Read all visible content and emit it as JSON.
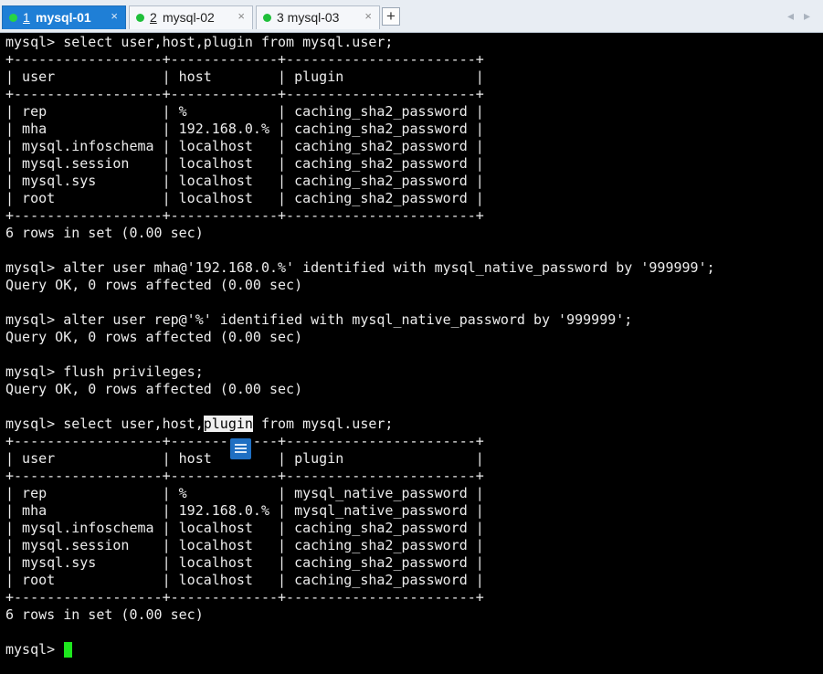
{
  "tabs": [
    {
      "number": "1",
      "label": "mysql-01",
      "active": true
    },
    {
      "number": "2",
      "label": "mysql-02",
      "active": false
    },
    {
      "number": "3",
      "label": "3 mysql-03",
      "active": false
    }
  ],
  "tab_close_glyph": "×",
  "add_tab_glyph": "+",
  "nav_prev_glyph": "◂",
  "nav_next_glyph": "▸",
  "terminal": {
    "lines": [
      "mysql> select user,host,plugin from mysql.user;",
      "+------------------+-------------+-----------------------+",
      "| user             | host        | plugin                |",
      "+------------------+-------------+-----------------------+",
      "| rep              | %           | caching_sha2_password |",
      "| mha              | 192.168.0.% | caching_sha2_password |",
      "| mysql.infoschema | localhost   | caching_sha2_password |",
      "| mysql.session    | localhost   | caching_sha2_password |",
      "| mysql.sys        | localhost   | caching_sha2_password |",
      "| root             | localhost   | caching_sha2_password |",
      "+------------------+-------------+-----------------------+",
      "6 rows in set (0.00 sec)",
      "",
      "mysql> alter user mha@'192.168.0.%' identified with mysql_native_password by '999999';",
      "Query OK, 0 rows affected (0.00 sec)",
      "",
      "mysql> alter user rep@'%' identified with mysql_native_password by '999999';",
      "Query OK, 0 rows affected (0.00 sec)",
      "",
      "mysql> flush privileges;",
      "Query OK, 0 rows affected (0.00 sec)",
      "",
      "mysql> select user,host,",
      "+------------------+-------------+-----------------------+",
      "| user             | host        | plugin                |",
      "+------------------+-------------+-----------------------+",
      "| rep              | %           | mysql_native_password |",
      "| mha              | 192.168.0.% | mysql_native_password |",
      "| mysql.infoschema | localhost   | caching_sha2_password |",
      "| mysql.session    | localhost   | caching_sha2_password |",
      "| mysql.sys        | localhost   | caching_sha2_password |",
      "| root             | localhost   | caching_sha2_password |",
      "+------------------+-------------+-----------------------+",
      "6 rows in set (0.00 sec)",
      "",
      "mysql> "
    ],
    "highlighted_word": "plugin",
    "after_highlight": " from mysql.user;",
    "cursor_color": "#1ee61e"
  },
  "colors": {
    "tab_active_bg": "#1f7fd6",
    "status_dot": "#1fbf3a",
    "terminal_bg": "#000000",
    "terminal_fg": "#ececec"
  }
}
